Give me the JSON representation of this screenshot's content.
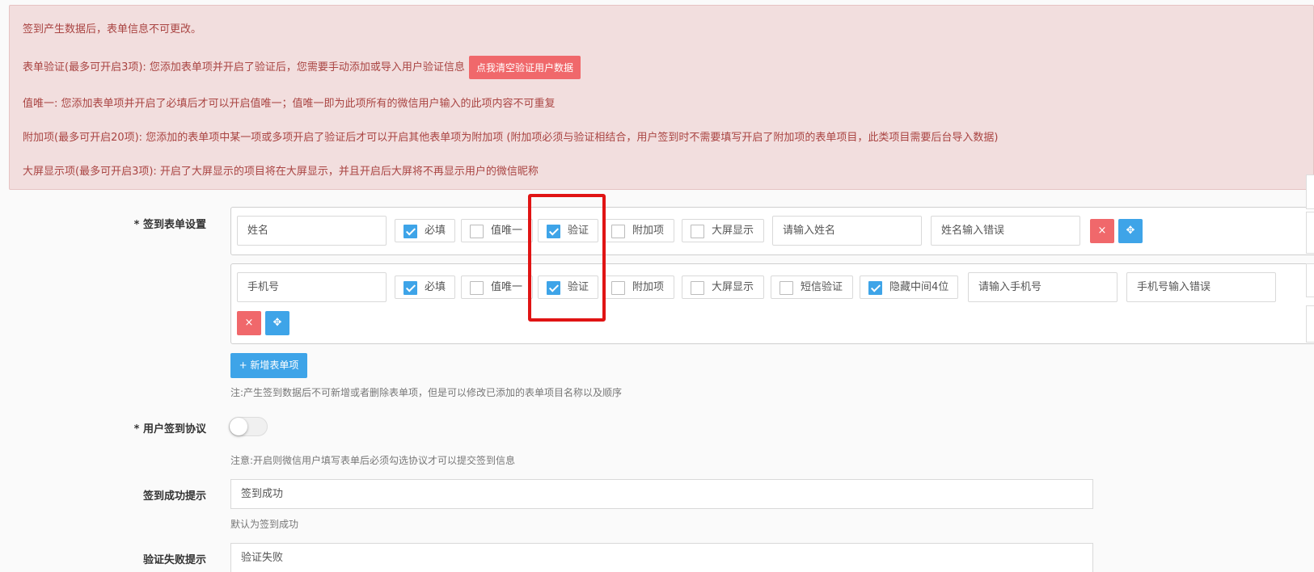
{
  "alert": {
    "line1": "签到产生数据后，表单信息不可更改。",
    "line2": "表单验证(最多可开启3项): 您添加表单项并开启了验证后，您需要手动添加或导入用户验证信息",
    "clear_button": "点我清空验证用户数据",
    "line3": "值唯一: 您添加表单项并开启了必填后才可以开启值唯一；值唯一即为此项所有的微信用户输入的此项内容不可重复",
    "line4": "附加项(最多可开启20项): 您添加的表单项中某一项或多项开启了验证后才可以开启其他表单项为附加项 (附加项必须与验证相结合，用户签到时不需要填写开启了附加项的表单项目，此类项目需要后台导入数据)",
    "line5": "大屏显示项(最多可开启3项): 开启了大屏显示的项目将在大屏显示，并且开启后大屏将不再显示用户的微信昵称"
  },
  "form_settings": {
    "label": "* 签到表单设置",
    "rows": [
      {
        "name": "姓名",
        "required": {
          "label": "必填",
          "checked": true
        },
        "unique": {
          "label": "值唯一",
          "checked": false
        },
        "verify": {
          "label": "验证",
          "checked": true
        },
        "extra": {
          "label": "附加项",
          "checked": false
        },
        "bigscreen": {
          "label": "大屏显示",
          "checked": false
        },
        "placeholder": "请输入姓名",
        "error": "姓名输入错误"
      },
      {
        "name": "手机号",
        "required": {
          "label": "必填",
          "checked": true
        },
        "unique": {
          "label": "值唯一",
          "checked": false
        },
        "verify": {
          "label": "验证",
          "checked": true
        },
        "extra": {
          "label": "附加项",
          "checked": false
        },
        "bigscreen": {
          "label": "大屏显示",
          "checked": false
        },
        "sms": {
          "label": "短信验证",
          "checked": false
        },
        "hide_middle": {
          "label": "隐藏中间4位",
          "checked": true
        },
        "placeholder": "请输入手机号",
        "error": "手机号输入错误"
      }
    ],
    "delete_glyph": "×",
    "move_glyph": "✥",
    "add_button": "+ 新增表单项",
    "note": "注:产生签到数据后不可新增或者删除表单项，但是可以修改已添加的表单项目名称以及顺序"
  },
  "agreement": {
    "label": "* 用户签到协议",
    "enabled": false,
    "note": "注意:开启则微信用户填写表单后必须勾选协议才可以提交签到信息"
  },
  "success_tip": {
    "label": "签到成功提示",
    "value": "签到成功",
    "note": "默认为签到成功"
  },
  "fail_tip": {
    "label": "验证失败提示",
    "value": "验证失败"
  },
  "colors": {
    "alert_bg": "#f2dede",
    "alert_text": "#a94442",
    "primary": "#3ea4e8",
    "danger": "#f0686b",
    "highlight": "#e01414"
  }
}
